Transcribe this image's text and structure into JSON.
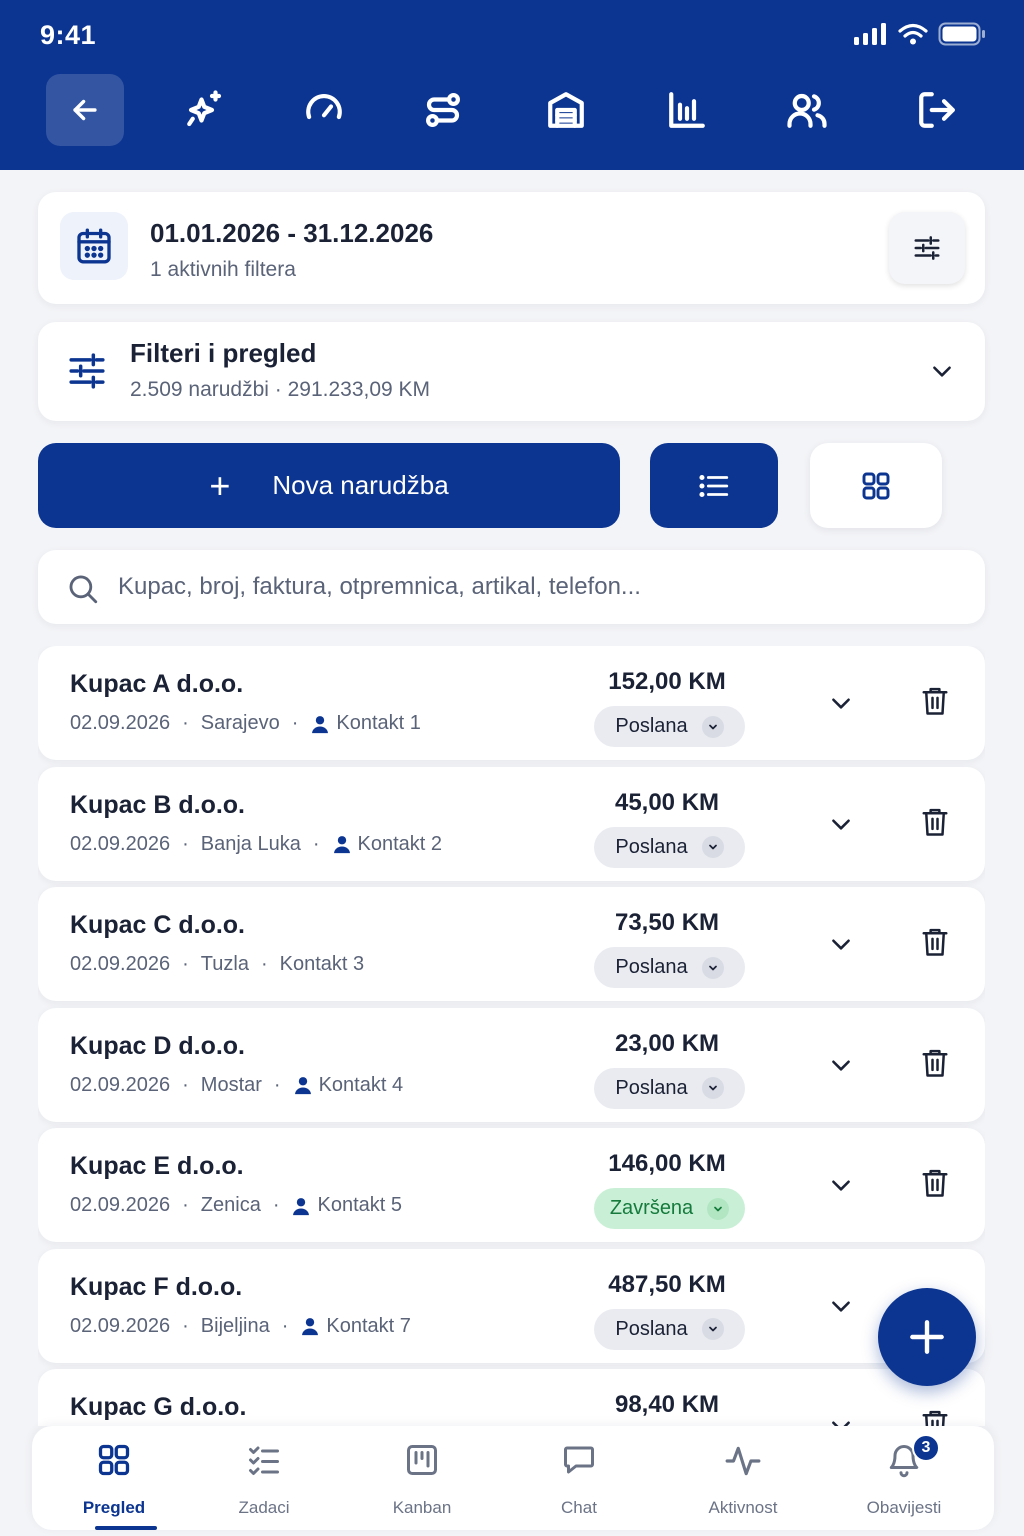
{
  "status_bar": {
    "time": "9:41"
  },
  "toolbar": {
    "icons": [
      "back-arrow-icon",
      "sparkles-icon",
      "gauge-icon",
      "route-icon",
      "warehouse-icon",
      "bar-chart-icon",
      "users-icon",
      "logout-icon"
    ],
    "active_index": 0
  },
  "date_card": {
    "range": "01.01.2026 - 31.12.2026",
    "active_filters": "1 aktivnih filtera"
  },
  "filters_card": {
    "title": "Filteri i pregled",
    "summary": "2.509 narudžbi · 291.233,09 KM"
  },
  "actions": {
    "new_order_label": "Nova narudžba",
    "plus": "+"
  },
  "search": {
    "placeholder": "Kupac, broj, faktura, otpremnica, artikal, telefon..."
  },
  "orders": [
    {
      "customer": "Kupac A d.o.o.",
      "date": "02.09.2026",
      "city": "Sarajevo",
      "contact": "Kontakt 1",
      "contact_icon": true,
      "amount": "152,00 KM",
      "status": "Poslana",
      "status_type": "sent"
    },
    {
      "customer": "Kupac B d.o.o.",
      "date": "02.09.2026",
      "city": "Banja Luka",
      "contact": "Kontakt 2",
      "contact_icon": true,
      "amount": "45,00 KM",
      "status": "Poslana",
      "status_type": "sent"
    },
    {
      "customer": "Kupac C d.o.o.",
      "date": "02.09.2026",
      "city": "Tuzla",
      "contact": "Kontakt 3",
      "contact_icon": false,
      "amount": "73,50 KM",
      "status": "Poslana",
      "status_type": "sent"
    },
    {
      "customer": "Kupac D d.o.o.",
      "date": "02.09.2026",
      "city": "Mostar",
      "contact": "Kontakt 4",
      "contact_icon": true,
      "amount": "23,00 KM",
      "status": "Poslana",
      "status_type": "sent"
    },
    {
      "customer": "Kupac E d.o.o.",
      "date": "02.09.2026",
      "city": "Zenica",
      "contact": "Kontakt 5",
      "contact_icon": true,
      "amount": "146,00 KM",
      "status": "Završena",
      "status_type": "done"
    },
    {
      "customer": "Kupac F d.o.o.",
      "date": "02.09.2026",
      "city": "Bijeljina",
      "contact": "Kontakt 7",
      "contact_icon": true,
      "amount": "487,50 KM",
      "status": "Poslana",
      "status_type": "sent"
    },
    {
      "customer": "Kupac G d.o.o.",
      "date": "",
      "city": "",
      "contact": "",
      "contact_icon": false,
      "amount": "98,40 KM",
      "status": "",
      "status_type": "sent"
    }
  ],
  "bottom_nav": {
    "items": [
      {
        "label": "Pregled",
        "icon": "grid-icon",
        "active": true
      },
      {
        "label": "Zadaci",
        "icon": "checklist-icon",
        "active": false
      },
      {
        "label": "Kanban",
        "icon": "kanban-icon",
        "active": false
      },
      {
        "label": "Chat",
        "icon": "chat-icon",
        "active": false
      },
      {
        "label": "Aktivnost",
        "icon": "activity-icon",
        "active": false
      },
      {
        "label": "Obavijesti",
        "icon": "bell-icon",
        "active": false
      }
    ],
    "notification_count": "3"
  },
  "colors": {
    "primary": "#0c3591",
    "background": "#f3f4f7",
    "status_sent_bg": "#e9ebf0",
    "status_done_bg": "#c9f0d6",
    "status_done_text": "#157a3c"
  }
}
